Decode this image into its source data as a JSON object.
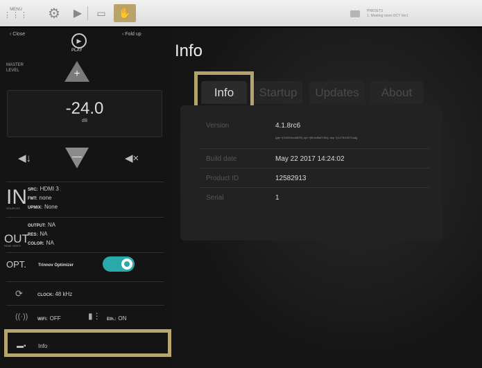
{
  "topbar": {
    "menu_label": "MENU",
    "presets_label": "PRESETS",
    "presets_value": "1. Meeting room OCT Ver1",
    "icons": [
      "menu-grid-icon",
      "gear-icon",
      "play-icon",
      "screen-icon",
      "hand-icon",
      "folder-icon"
    ],
    "accent_color": "#b8a36b"
  },
  "sidebar": {
    "close_label": "Close",
    "foldup_label": "Fold up",
    "logo_text": "PLAY",
    "master_level_label": "MASTER LEVEL",
    "volume_value": "-24.0",
    "volume_unit": "dB",
    "inputs": {
      "big": "IN",
      "sub": "SOURCES",
      "lines": [
        {
          "key": "SRC:",
          "value": "HDMI 3"
        },
        {
          "key": "FMT:",
          "value": "none"
        },
        {
          "key": "UPMIX:",
          "value": "None"
        }
      ]
    },
    "outputs": {
      "big": "OUT",
      "sub": "HDMI VIDEO",
      "lines": [
        {
          "key": "OUTPUT:",
          "value": "NA"
        },
        {
          "key": "RES:",
          "value": "NA"
        },
        {
          "key": "COLOR:",
          "value": "NA"
        }
      ]
    },
    "optimizer": {
      "label": "OPT.",
      "name": "Trinnov Optimizer",
      "enabled": true,
      "toggle_color": "#2aa9a9"
    },
    "clock": {
      "key": "CLOCK:",
      "value": "48 kHz"
    },
    "wifi": {
      "key": "WiFi:",
      "value": "OFF"
    },
    "eth": {
      "key": "Eth.:",
      "value": "ON"
    },
    "info_item_label": "Info"
  },
  "main": {
    "title": "Info",
    "tabs": [
      {
        "label": "Info",
        "active": true
      },
      {
        "label": "Startup",
        "active": false
      },
      {
        "label": "Updates",
        "active": false
      },
      {
        "label": "About",
        "active": false
      }
    ],
    "rows": [
      {
        "label": "Version",
        "value": "4.1.8rc6",
        "sub": "(gtp +[24431bcc8825], opt +[6b4cf8af740c], dsp +[1c71b16371aa])"
      },
      {
        "label": "Build date",
        "value": "May 22 2017 14:24:02"
      },
      {
        "label": "Product ID",
        "value": "12582913"
      },
      {
        "label": "Serial",
        "value": "1"
      }
    ]
  }
}
